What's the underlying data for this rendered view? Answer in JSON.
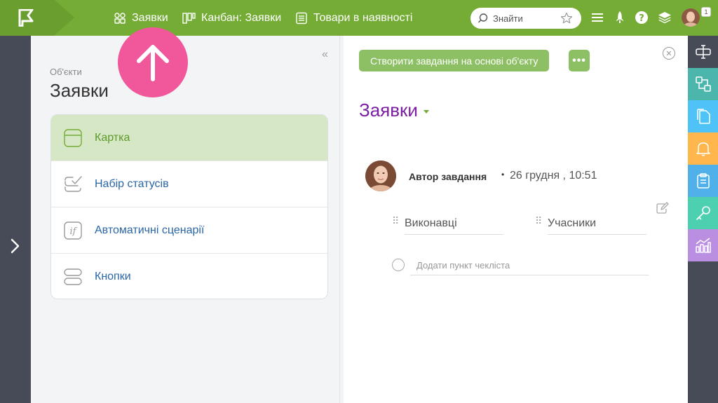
{
  "topbar": {
    "nav": [
      {
        "label": "Заявки"
      },
      {
        "label": "Канбан: Заявки"
      },
      {
        "label": "Товари в наявності"
      }
    ],
    "search_placeholder": "Знайти",
    "notification_count": "1"
  },
  "left_panel": {
    "section_label": "Об'єкти",
    "title": "Заявки",
    "menu": [
      {
        "label": "Картка",
        "active": true
      },
      {
        "label": "Набір статусів",
        "active": false
      },
      {
        "label": "Автоматичні сценарії",
        "active": false
      },
      {
        "label": "Кнопки",
        "active": false
      }
    ]
  },
  "main": {
    "create_task_label": "Створити завдання на основі об'єкту",
    "more_label": "•••",
    "task_title": "Заявки",
    "author_label": "Автор завдання",
    "author_sep": "•",
    "date": "26 грудня , 10:51",
    "assignees_label": "Виконавці",
    "participants_label": "Учасники",
    "checklist_placeholder": "Додати пункт чекліста"
  },
  "right_sidebar": {
    "items": [
      {
        "icon": "text-field-icon",
        "color": "#474b57"
      },
      {
        "icon": "relations-icon",
        "color": "#4db6ac"
      },
      {
        "icon": "documents-icon",
        "color": "#4fc3f7"
      },
      {
        "icon": "bell-icon",
        "color": "#ffb74d"
      },
      {
        "icon": "clipboard-icon",
        "color": "#4fb0ea"
      },
      {
        "icon": "key-icon",
        "color": "#4dd0b0"
      },
      {
        "icon": "chart-icon",
        "color": "#ba8ee0"
      }
    ]
  },
  "colors": {
    "brand_green": "#74ac35",
    "button_green": "#8dbf64",
    "title_purple": "#7b1fa2",
    "link_blue": "#2a66a6",
    "highlight_pink": "#f0589b"
  }
}
